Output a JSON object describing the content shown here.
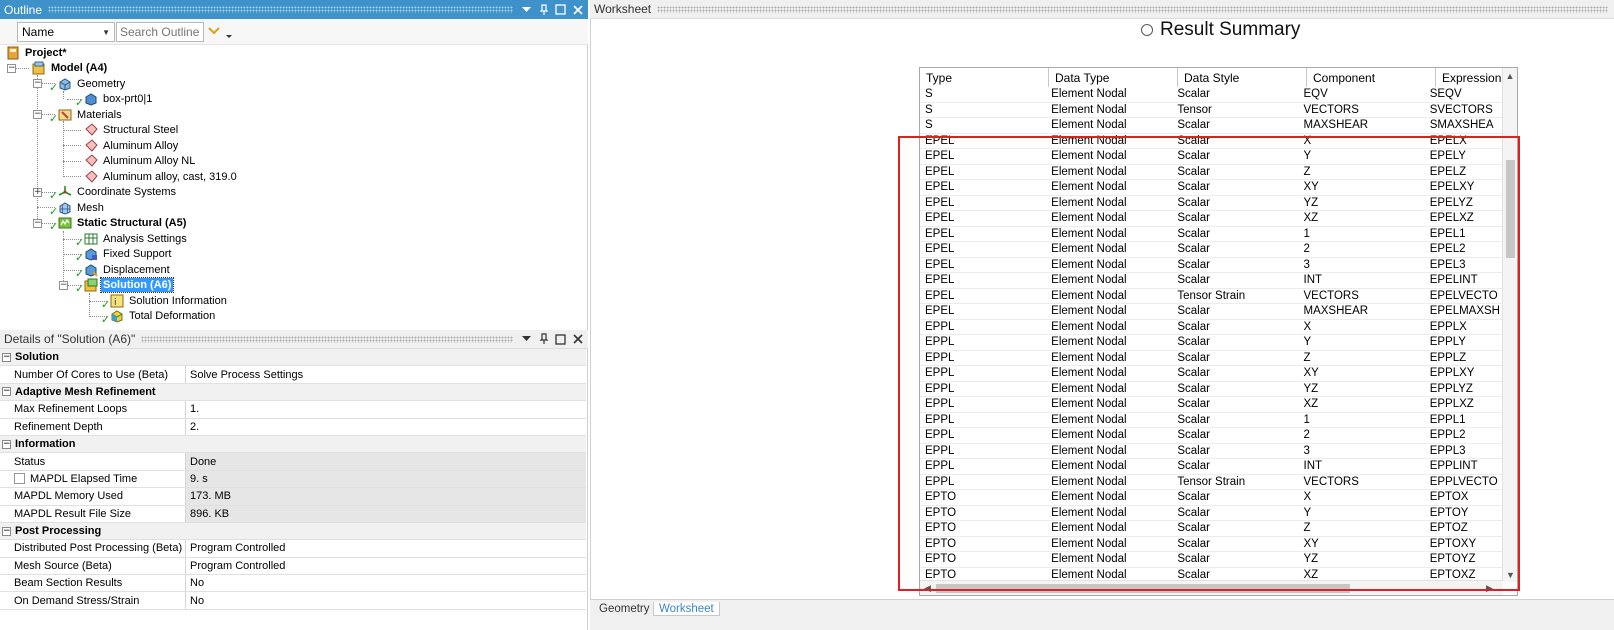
{
  "outline": {
    "title": "Outline",
    "filter_select": "Name",
    "search_placeholder": "Search Outline",
    "tree": {
      "project": "Project*",
      "model": "Model (A4)",
      "geometry": "Geometry",
      "part": "box-prt0|1",
      "materials": "Materials",
      "materials_items": [
        "Structural Steel",
        "Aluminum Alloy",
        "Aluminum Alloy NL",
        "Aluminum alloy, cast, 319.0"
      ],
      "coordinate_systems": "Coordinate Systems",
      "mesh": "Mesh",
      "static_structural": "Static Structural (A5)",
      "analysis_settings": "Analysis Settings",
      "fixed_support": "Fixed Support",
      "displacement": "Displacement",
      "solution": "Solution (A6)",
      "solution_information": "Solution Information",
      "total_deformation": "Total Deformation"
    }
  },
  "details": {
    "title": "Details of \"Solution (A6)\"",
    "sections": [
      {
        "name": "Solution",
        "rows": [
          {
            "label": "Number Of Cores to Use (Beta)",
            "value": "Solve Process Settings"
          }
        ]
      },
      {
        "name": "Adaptive Mesh Refinement",
        "rows": [
          {
            "label": "Max Refinement Loops",
            "value": "1."
          },
          {
            "label": "Refinement Depth",
            "value": "2."
          }
        ]
      },
      {
        "name": "Information",
        "rows": [
          {
            "label": "Status",
            "value": "Done"
          },
          {
            "label": "MAPDL Elapsed Time",
            "value": "9. s"
          },
          {
            "label": "MAPDL Memory Used",
            "value": "173. MB"
          },
          {
            "label": "MAPDL Result File Size",
            "value": "896. KB"
          }
        ]
      },
      {
        "name": "Post Processing",
        "rows": [
          {
            "label": "Distributed Post Processing (Beta)",
            "value": "Program Controlled"
          },
          {
            "label": "Mesh Source (Beta)",
            "value": "Program Controlled"
          },
          {
            "label": "Beam Section Results",
            "value": "No"
          },
          {
            "label": "On Demand Stress/Strain",
            "value": "No"
          }
        ]
      }
    ]
  },
  "worksheet": {
    "title": "Worksheet",
    "heading": "Result Summary",
    "columns": [
      "Type",
      "Data Type",
      "Data Style",
      "Component",
      "Expression"
    ],
    "rows": [
      [
        "S",
        "Element Nodal",
        "Scalar",
        "EQV",
        "SEQV"
      ],
      [
        "S",
        "Element Nodal",
        "Tensor",
        "VECTORS",
        "SVECTORS"
      ],
      [
        "S",
        "Element Nodal",
        "Scalar",
        "MAXSHEAR",
        "SMAXSHEA"
      ],
      [
        "EPEL",
        "Element Nodal",
        "Scalar",
        "X",
        "EPELX"
      ],
      [
        "EPEL",
        "Element Nodal",
        "Scalar",
        "Y",
        "EPELY"
      ],
      [
        "EPEL",
        "Element Nodal",
        "Scalar",
        "Z",
        "EPELZ"
      ],
      [
        "EPEL",
        "Element Nodal",
        "Scalar",
        "XY",
        "EPELXY"
      ],
      [
        "EPEL",
        "Element Nodal",
        "Scalar",
        "YZ",
        "EPELYZ"
      ],
      [
        "EPEL",
        "Element Nodal",
        "Scalar",
        "XZ",
        "EPELXZ"
      ],
      [
        "EPEL",
        "Element Nodal",
        "Scalar",
        "1",
        "EPEL1"
      ],
      [
        "EPEL",
        "Element Nodal",
        "Scalar",
        "2",
        "EPEL2"
      ],
      [
        "EPEL",
        "Element Nodal",
        "Scalar",
        "3",
        "EPEL3"
      ],
      [
        "EPEL",
        "Element Nodal",
        "Scalar",
        "INT",
        "EPELINT"
      ],
      [
        "EPEL",
        "Element Nodal",
        "Tensor Strain",
        "VECTORS",
        "EPELVECTO"
      ],
      [
        "EPEL",
        "Element Nodal",
        "Scalar",
        "MAXSHEAR",
        "EPELMAXSH"
      ],
      [
        "EPPL",
        "Element Nodal",
        "Scalar",
        "X",
        "EPPLX"
      ],
      [
        "EPPL",
        "Element Nodal",
        "Scalar",
        "Y",
        "EPPLY"
      ],
      [
        "EPPL",
        "Element Nodal",
        "Scalar",
        "Z",
        "EPPLZ"
      ],
      [
        "EPPL",
        "Element Nodal",
        "Scalar",
        "XY",
        "EPPLXY"
      ],
      [
        "EPPL",
        "Element Nodal",
        "Scalar",
        "YZ",
        "EPPLYZ"
      ],
      [
        "EPPL",
        "Element Nodal",
        "Scalar",
        "XZ",
        "EPPLXZ"
      ],
      [
        "EPPL",
        "Element Nodal",
        "Scalar",
        "1",
        "EPPL1"
      ],
      [
        "EPPL",
        "Element Nodal",
        "Scalar",
        "2",
        "EPPL2"
      ],
      [
        "EPPL",
        "Element Nodal",
        "Scalar",
        "3",
        "EPPL3"
      ],
      [
        "EPPL",
        "Element Nodal",
        "Scalar",
        "INT",
        "EPPLINT"
      ],
      [
        "EPPL",
        "Element Nodal",
        "Tensor Strain",
        "VECTORS",
        "EPPLVECTO"
      ],
      [
        "EPTO",
        "Element Nodal",
        "Scalar",
        "X",
        "EPTOX"
      ],
      [
        "EPTO",
        "Element Nodal",
        "Scalar",
        "Y",
        "EPTOY"
      ],
      [
        "EPTO",
        "Element Nodal",
        "Scalar",
        "Z",
        "EPTOZ"
      ],
      [
        "EPTO",
        "Element Nodal",
        "Scalar",
        "XY",
        "EPTOXY"
      ],
      [
        "EPTO",
        "Element Nodal",
        "Scalar",
        "YZ",
        "EPTOYZ"
      ],
      [
        "EPTO",
        "Element Nodal",
        "Scalar",
        "XZ",
        "EPTOXZ"
      ]
    ],
    "tabs": [
      "Geometry",
      "Worksheet"
    ]
  },
  "colors": {
    "active_header": "#3e92c9",
    "check_green": "#1f9e1f",
    "selection": "#3399ff",
    "highlight_red": "#e0201e"
  }
}
